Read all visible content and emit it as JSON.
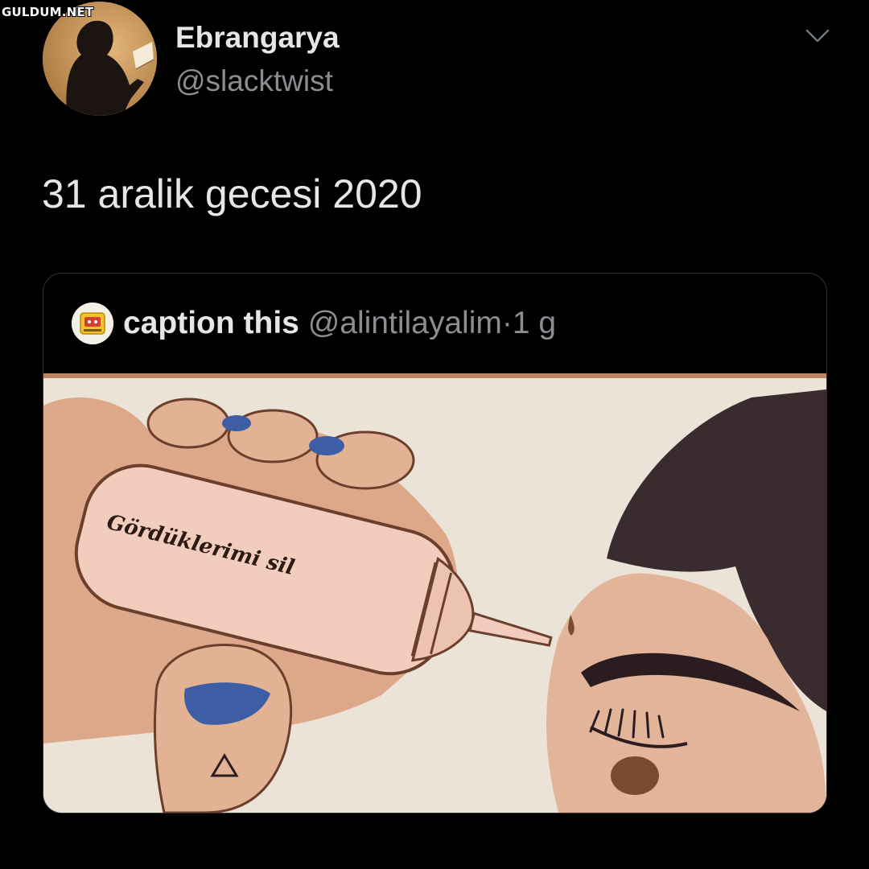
{
  "watermark": "GULDUM.NET",
  "tweet": {
    "author": {
      "display_name": "Ebrangarya",
      "handle": "@slacktwist"
    },
    "menu_icon": "chevron-down-icon",
    "text": "31 aralik gecesi 2020"
  },
  "quoted_tweet": {
    "author": {
      "display_name": "caption this",
      "handle": "@alintilayalim"
    },
    "separator": "·",
    "time": "1 g",
    "image": {
      "bottle_label": "Gördüklerimi sil"
    }
  }
}
